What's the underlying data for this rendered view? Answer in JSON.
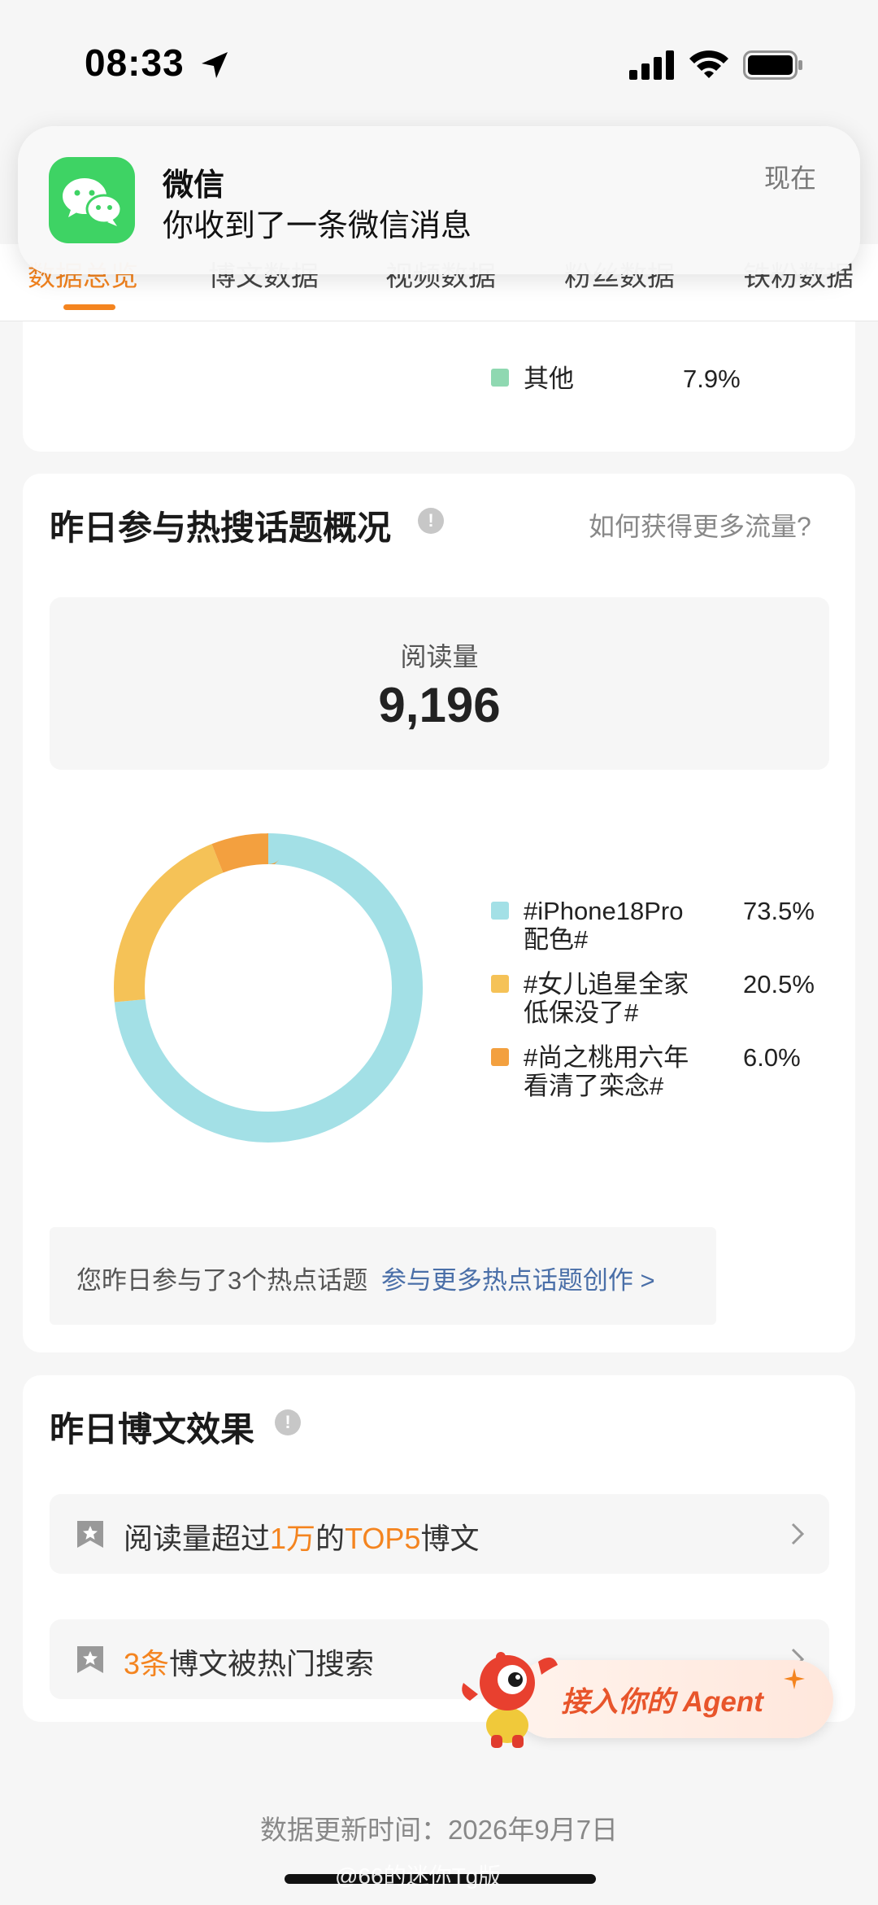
{
  "status_bar": {
    "time": "08:33"
  },
  "notification": {
    "app": "微信",
    "message": "你收到了一条微信消息",
    "time": "现在"
  },
  "tabs": [
    {
      "label": "数据总览",
      "active": true
    },
    {
      "label": "博文数据",
      "active": false
    },
    {
      "label": "视频数据",
      "active": false
    },
    {
      "label": "粉丝数据",
      "active": false
    },
    {
      "label": "铁粉数据",
      "active": false
    }
  ],
  "prev_legend": {
    "label": "其他",
    "percent": "7.9%",
    "color": "#8fd8b1"
  },
  "hot_topics": {
    "title": "昨日参与热搜话题概况",
    "help_link": "如何获得更多流量?",
    "read_label": "阅读量",
    "read_value": "9,196",
    "summary_text": "您昨日参与了3个热点话题",
    "summary_link": "参与更多热点话题创作 >"
  },
  "chart_data": {
    "type": "pie",
    "donut": true,
    "series": [
      {
        "name": "#iPhone18Pro配色#",
        "label_line1": "#iPhone18Pro",
        "label_line2": "配色#",
        "value": 73.5,
        "percent": "73.5%",
        "color": "#a3e0e6"
      },
      {
        "name": "#女儿追星全家低保没了#",
        "label_line1": "#女儿追星全家",
        "label_line2": "低保没了#",
        "value": 20.5,
        "percent": "20.5%",
        "color": "#f5c257"
      },
      {
        "name": "#尚之桃用六年看清了栾念#",
        "label_line1": "#尚之桃用六年",
        "label_line2": "看清了栾念#",
        "value": 6.0,
        "percent": "6.0%",
        "color": "#f3a03f"
      }
    ],
    "legend_position": "right"
  },
  "post_effect": {
    "title": "昨日博文效果",
    "row1": {
      "prefix": "阅读量超过",
      "highlight1": "1万",
      "mid": "的",
      "highlight2": "TOP5",
      "suffix": "博文"
    },
    "row2": {
      "highlight": "3条",
      "suffix": "博文被热门搜索"
    }
  },
  "agent": {
    "label": "接入你的 Agent"
  },
  "footer": {
    "update_time": "数据更新时间：2026年9月7日"
  },
  "watermark": "@66的迷你Tg版"
}
